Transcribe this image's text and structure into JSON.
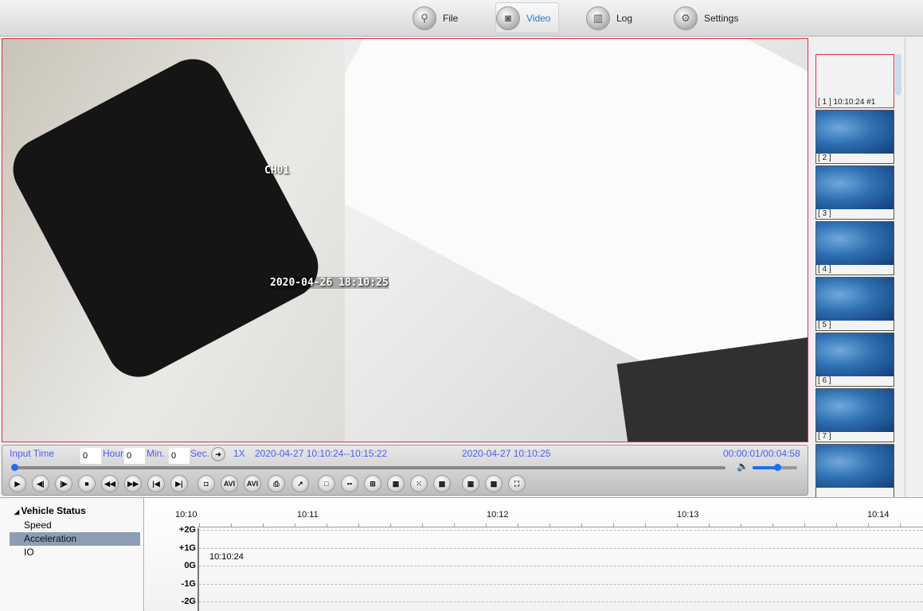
{
  "nav": {
    "tabs": [
      {
        "label": "File",
        "icon": "search-icon"
      },
      {
        "label": "Video",
        "icon": "camera-icon",
        "active": true
      },
      {
        "label": "Log",
        "icon": "log-icon"
      },
      {
        "label": "Settings",
        "icon": "gear-icon"
      }
    ]
  },
  "video": {
    "channel": "CH01",
    "timestamp": "2020-04-26 18:10:25"
  },
  "controls": {
    "input_time": "Input Time",
    "hour_value": "0",
    "hour": "Hour",
    "min_value": "0",
    "min": "Min.",
    "sec_value": "0",
    "sec": "Sec.",
    "speed": "1X",
    "range": "2020-04-27 10:10:24--10:15:22",
    "current": "2020-04-27 10:10:25",
    "elapsed": "00:00:01/00:04:58",
    "progress_percent": 0.3,
    "volume_percent": 55,
    "buttons": [
      "play",
      "step-back",
      "step-forward",
      "stop",
      "rewind",
      "fast-forward",
      "skip-start",
      "skip-end",
      "snapshot",
      "AVI",
      "AVI",
      "print",
      "chart",
      "1-split",
      "2-split",
      "4-split",
      "6-split",
      "9-split",
      "12-split",
      "16-split",
      "25-split",
      "fullscreen"
    ]
  },
  "thumbnails": [
    "[ 1 ] 10:10:24 #1",
    "[ 2 ]",
    "[ 3 ]",
    "[ 4 ]",
    "[ 5 ]",
    "[ 6 ]",
    "[ 7 ]",
    ""
  ],
  "tree": {
    "root": "Vehicle Status",
    "items": [
      "Speed",
      "Acceleration",
      "IO"
    ],
    "selected": "Acceleration"
  },
  "chart_data": {
    "type": "line",
    "x_ticks": [
      "10:10",
      "10:11",
      "10:12",
      "10:13",
      "10:14"
    ],
    "y_ticks": [
      "+2G",
      "+1G",
      "0G",
      "-1G",
      "-2G"
    ],
    "annotation": "10:10:24",
    "grid": true,
    "series": []
  },
  "colors": {
    "accent": "#4a5cf0",
    "selection": "#e03040"
  }
}
